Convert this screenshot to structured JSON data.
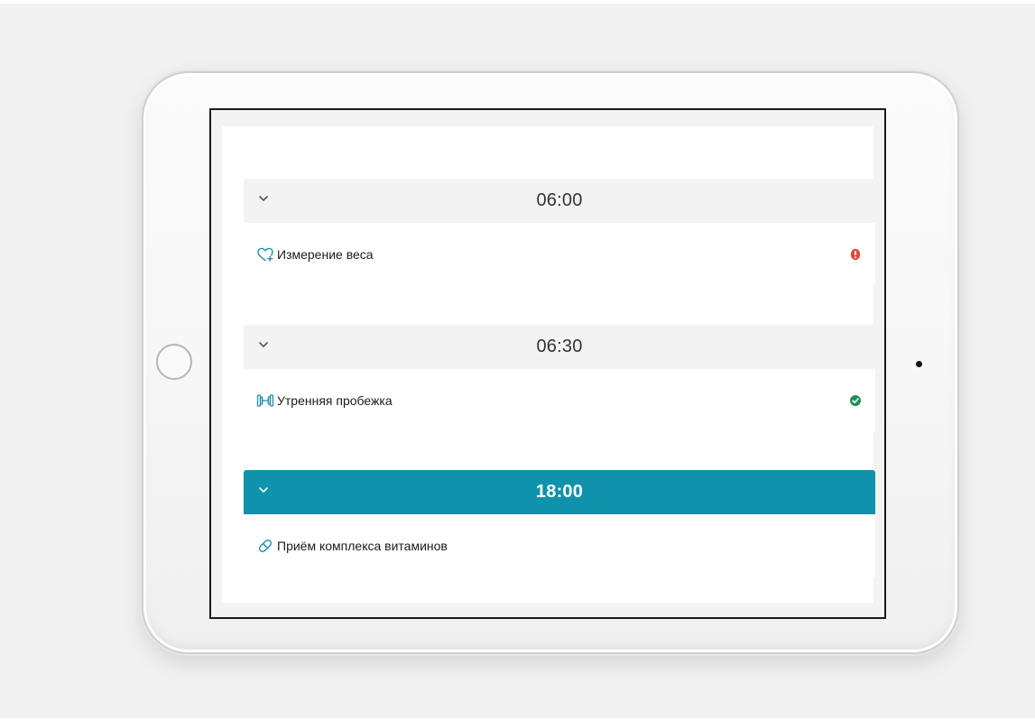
{
  "schedule": {
    "sections": [
      {
        "time": "06:00",
        "active": false,
        "item": {
          "label": "Измерение веса",
          "icon": "heart-plus-icon",
          "status": "error",
          "status_color": "#e04b3f"
        }
      },
      {
        "time": "06:30",
        "active": false,
        "item": {
          "label": "Утренняя пробежка",
          "icon": "dumbbell-icon",
          "status": "done",
          "status_color": "#1f8f57"
        }
      },
      {
        "time": "18:00",
        "active": true,
        "item": {
          "label": "Приём комплекса витаминов",
          "icon": "pill-icon",
          "status": "",
          "status_color": ""
        }
      }
    ]
  },
  "theme": {
    "accent": "#0f92ab",
    "header_bg": "#f3f3f4",
    "icon_color": "#1f8ea7"
  }
}
